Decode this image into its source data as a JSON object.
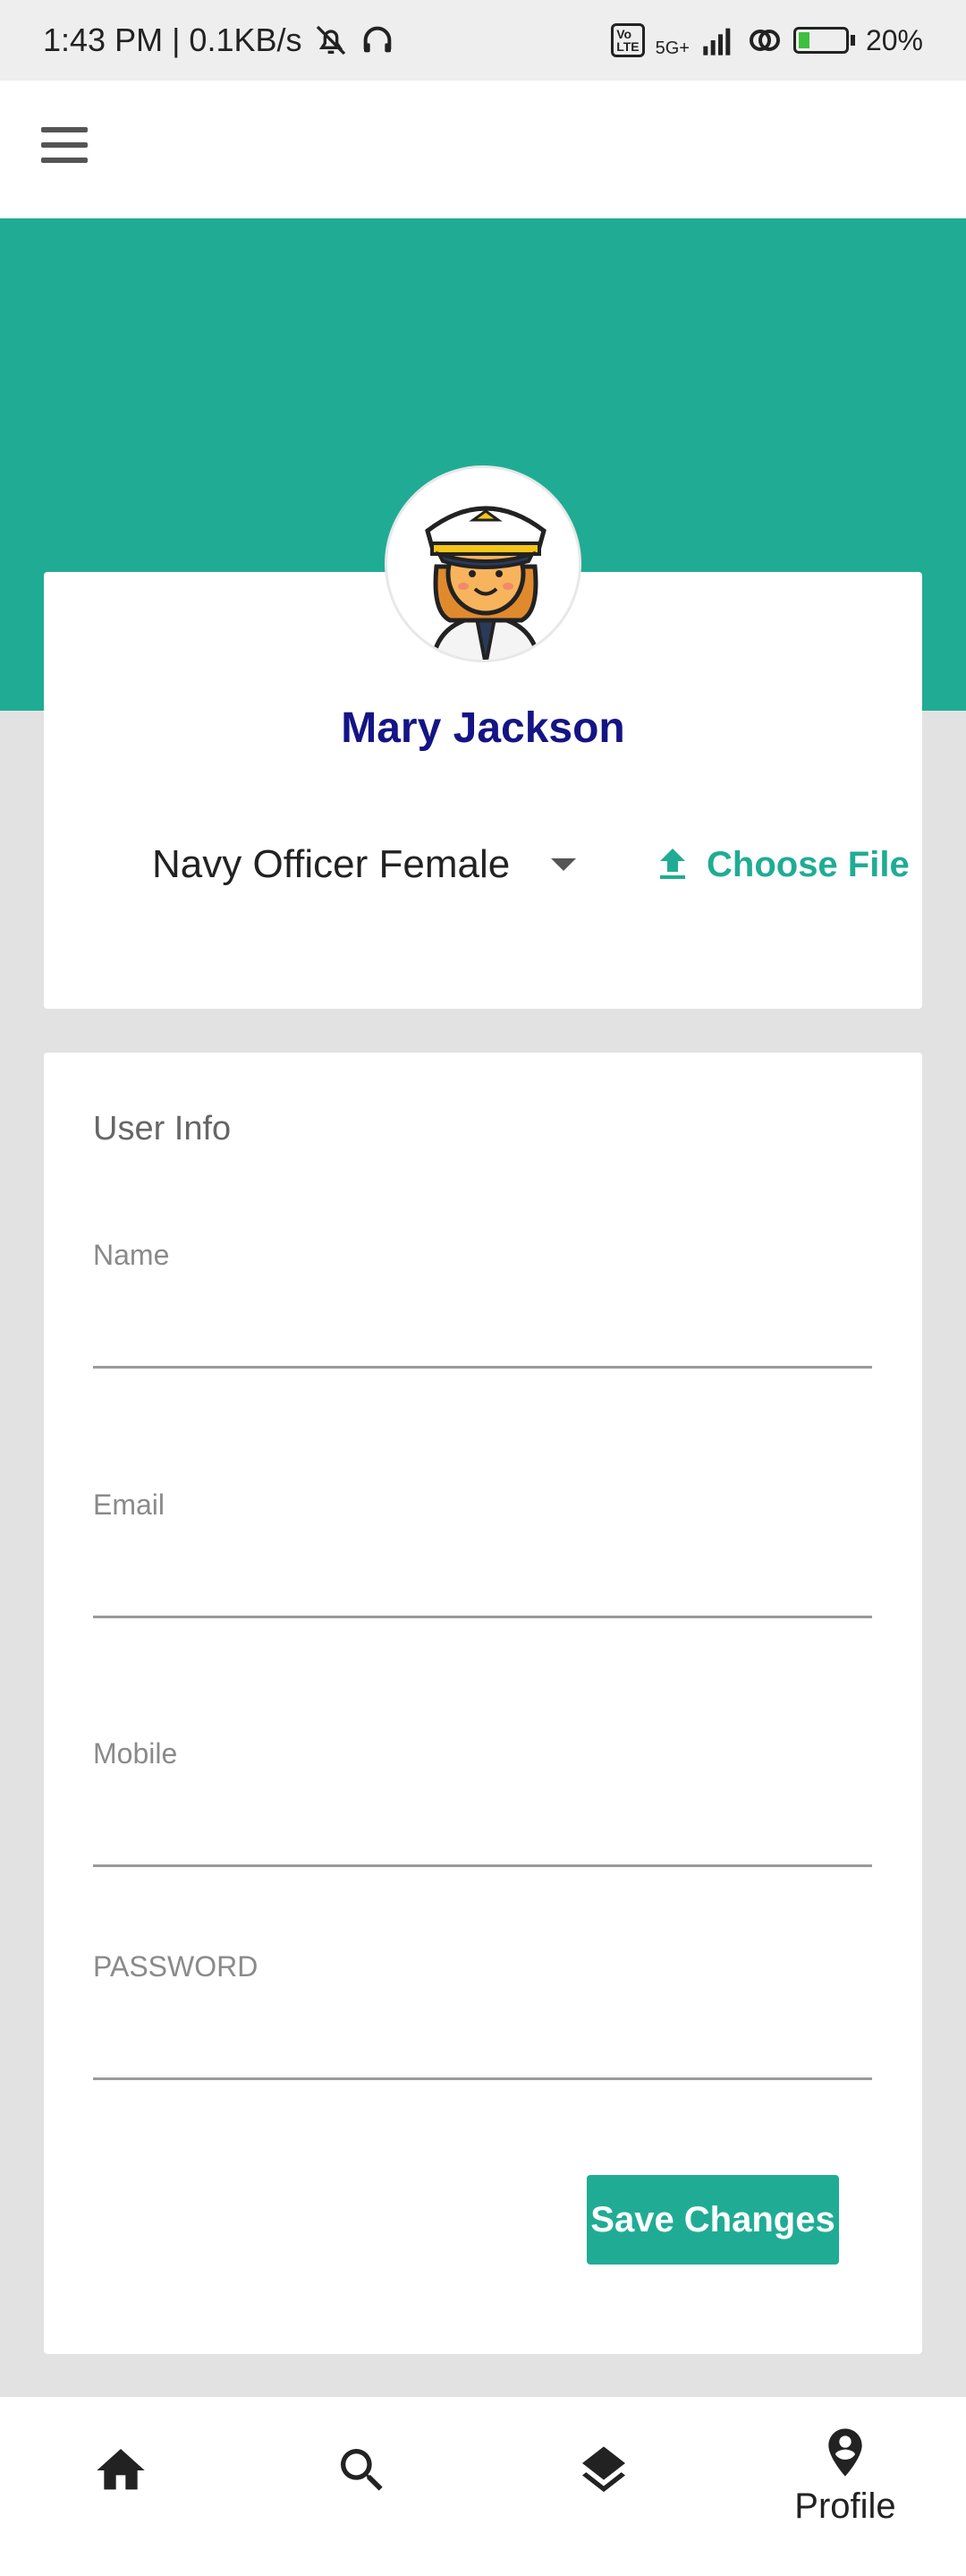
{
  "status_bar": {
    "time_speed": "1:43 PM | 0.1KB/s",
    "network": "5G+",
    "battery": "20%"
  },
  "profile": {
    "name": "Mary Jackson",
    "role_selected": "Navy Officer Female",
    "choose_file_label": "Choose File"
  },
  "user_info": {
    "title": "User Info",
    "fields": [
      {
        "label": "Name",
        "value": ""
      },
      {
        "label": "Email",
        "value": ""
      },
      {
        "label": "Mobile",
        "value": ""
      },
      {
        "label": "PASSWORD",
        "value": ""
      }
    ],
    "save_label": "Save Changes"
  },
  "bottom_nav": {
    "items": [
      {
        "icon": "home-icon",
        "label": ""
      },
      {
        "icon": "search-icon",
        "label": ""
      },
      {
        "icon": "layers-icon",
        "label": ""
      },
      {
        "icon": "profile-pin-icon",
        "label": "Profile"
      }
    ]
  },
  "colors": {
    "accent": "#20ac94",
    "name_color": "#141485",
    "background": "#e2e2e2"
  }
}
